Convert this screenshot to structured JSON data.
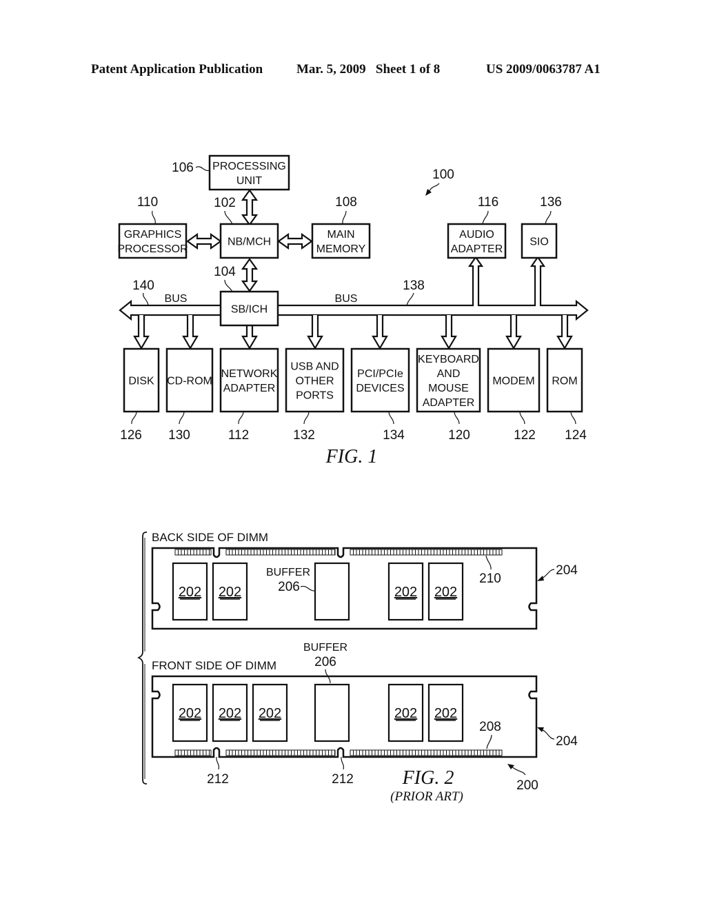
{
  "header": {
    "left": "Patent Application Publication",
    "center": "Mar. 5, 2009   Sheet 1 of 8",
    "right": "US 2009/0063787 A1"
  },
  "fig1": {
    "caption": "FIG. 1",
    "system_ref": "100",
    "bus_left": {
      "label": "BUS",
      "ref": "140"
    },
    "bus_right": {
      "label": "BUS",
      "ref": "138"
    },
    "blocks": {
      "processing_unit": {
        "lines": [
          "PROCESSING",
          "UNIT"
        ],
        "ref": "106"
      },
      "graphics_processor": {
        "lines": [
          "GRAPHICS",
          "PROCESSOR"
        ],
        "ref": "110"
      },
      "nb_mch": {
        "lines": [
          "NB/MCH"
        ],
        "ref": "102"
      },
      "main_memory": {
        "lines": [
          "MAIN",
          "MEMORY"
        ],
        "ref": "108"
      },
      "audio_adapter": {
        "lines": [
          "AUDIO",
          "ADAPTER"
        ],
        "ref": "116"
      },
      "sio": {
        "lines": [
          "SIO"
        ],
        "ref": "136"
      },
      "sb_ich": {
        "lines": [
          "SB/ICH"
        ],
        "ref": "104"
      },
      "disk": {
        "lines": [
          "DISK"
        ],
        "ref": "126"
      },
      "cd_rom": {
        "lines": [
          "CD-ROM"
        ],
        "ref": "130"
      },
      "network_adapter": {
        "lines": [
          "NETWORK",
          "ADAPTER"
        ],
        "ref": "112"
      },
      "usb_ports": {
        "lines": [
          "USB AND",
          "OTHER",
          "PORTS"
        ],
        "ref": "132"
      },
      "pci_devices": {
        "lines": [
          "PCI/PCIe",
          "DEVICES"
        ],
        "ref": "134"
      },
      "kbd_mouse": {
        "lines": [
          "KEYBOARD",
          "AND",
          "MOUSE",
          "ADAPTER"
        ],
        "ref": "120"
      },
      "modem": {
        "lines": [
          "MODEM"
        ],
        "ref": "122"
      },
      "rom": {
        "lines": [
          "ROM"
        ],
        "ref": "124"
      }
    }
  },
  "fig2": {
    "caption": "FIG. 2",
    "subcaption": "(PRIOR ART)",
    "assembly_ref": "200",
    "back": {
      "title": "BACK SIDE OF DIMM",
      "module_ref": "204",
      "buffer_label": "BUFFER",
      "buffer_ref": "206",
      "pins_ref": "210",
      "chip_refs": [
        "202",
        "202",
        "202",
        "202"
      ]
    },
    "front": {
      "title": "FRONT SIDE OF DIMM",
      "module_ref": "204",
      "buffer_label": "BUFFER",
      "buffer_ref": "206",
      "pins_ref": "208",
      "notch_ref": "212",
      "chip_refs": [
        "202",
        "202",
        "202",
        "202",
        "202"
      ]
    }
  }
}
